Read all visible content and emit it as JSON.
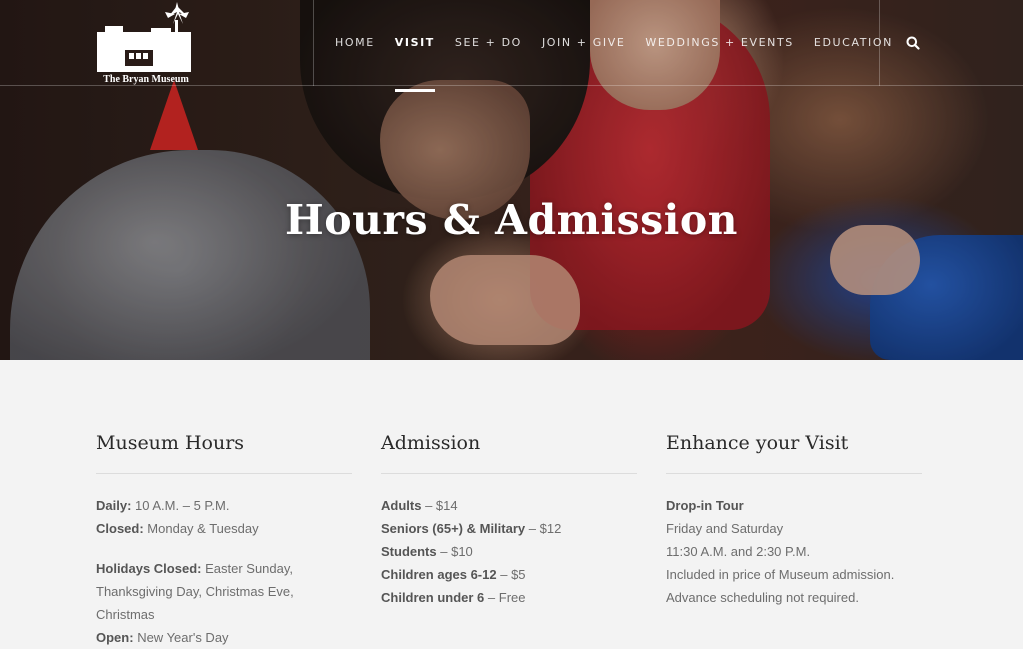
{
  "header": {
    "logo_text": "The Bryan Museum",
    "nav": [
      {
        "label": "HOME",
        "active": false
      },
      {
        "label": "VISIT",
        "active": true
      },
      {
        "label": "SEE + DO",
        "active": false
      },
      {
        "label": "JOIN + GIVE",
        "active": false
      },
      {
        "label": "WEDDINGS + EVENTS",
        "active": false
      },
      {
        "label": "EDUCATION",
        "active": false
      }
    ],
    "search_icon": "search-icon"
  },
  "hero": {
    "title": "Hours & Admission"
  },
  "columns": {
    "hours": {
      "heading": "Museum Hours",
      "daily_label": "Daily:",
      "daily_value": "10 A.M. – 5 P.M.",
      "closed_label": "Closed:",
      "closed_value": "Monday & Tuesday",
      "holidays_label": "Holidays Closed:",
      "holidays_value": "Easter Sunday, Thanksgiving Day, Christmas Eve, Christmas",
      "open_label": "Open:",
      "open_value": "New Year's Day"
    },
    "admission": {
      "heading": "Admission",
      "rows": [
        {
          "label": "Adults",
          "price": "– $14"
        },
        {
          "label": "Seniors (65+) & Military",
          "price": "– $12"
        },
        {
          "label": "Students",
          "price": "– $10"
        },
        {
          "label": "Children ages 6-12",
          "price": "– $5"
        },
        {
          "label": "Children under 6",
          "price": "– Free"
        }
      ]
    },
    "enhance": {
      "heading": "Enhance your Visit",
      "tour_label": "Drop-in Tour",
      "lines": [
        "Friday and Saturday",
        "11:30 A.M. and 2:30 P.M.",
        "Included in price of Museum admission.",
        "Advance scheduling not required."
      ]
    }
  },
  "colors": {
    "page_bg": "#f3f3f3",
    "heading": "#2a2a2a",
    "body_text": "#6d6d6d"
  }
}
